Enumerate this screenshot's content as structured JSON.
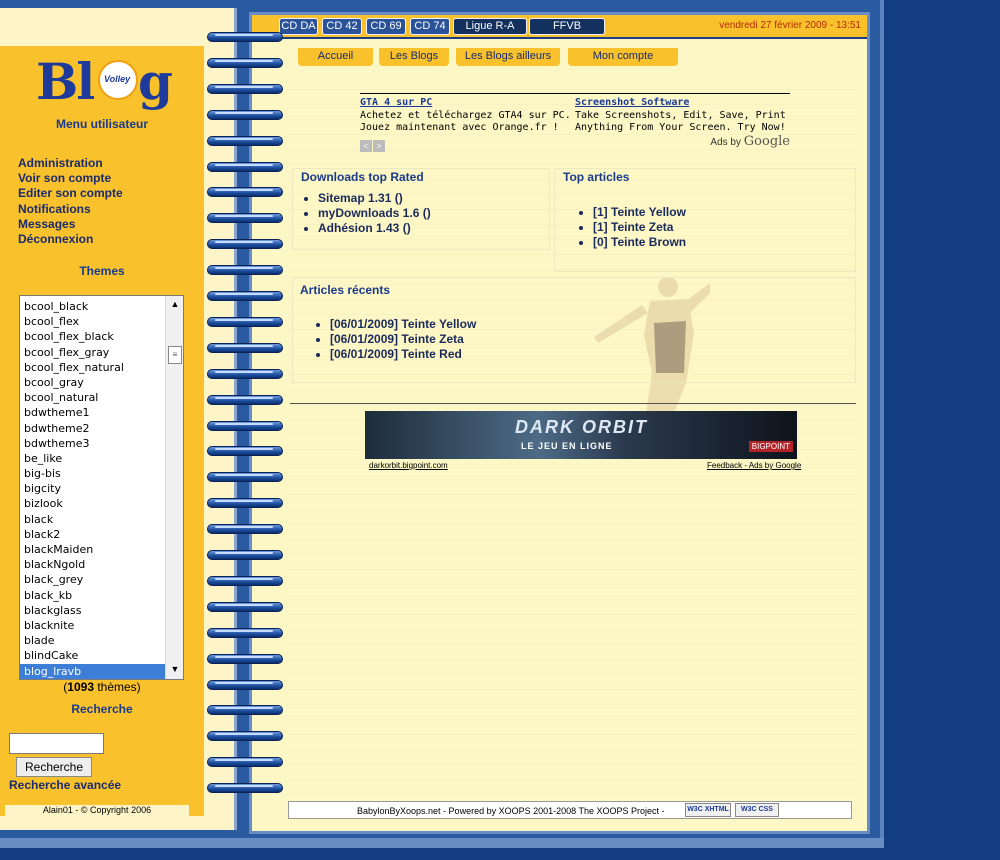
{
  "colors": {
    "accent": "#f9c22c",
    "frame": "#2a5aa0",
    "paper": "#fdf7c6",
    "title": "#1a3a8a"
  },
  "logo": {
    "left": "Bl",
    "right": "g",
    "ball_text": "Volley"
  },
  "sidebar": {
    "menu_title": "Menu utilisateur",
    "menu": [
      "Administration",
      "Voir son compte",
      "Editer son compte",
      "Notifications",
      "Messages",
      "Déconnexion"
    ],
    "themes_title": "Themes",
    "themes": [
      "bcool_black",
      "bcool_flex",
      "bcool_flex_black",
      "bcool_flex_gray",
      "bcool_flex_natural",
      "bcool_gray",
      "bcool_natural",
      "bdwtheme1",
      "bdwtheme2",
      "bdwtheme3",
      "be_like",
      "big-bis",
      "bigcity",
      "bizlook",
      "black",
      "black2",
      "blackMaiden",
      "blackNgold",
      "black_grey",
      "black_kb",
      "blackglass",
      "blacknite",
      "blade",
      "blindCake",
      "blog_lravb"
    ],
    "selected_theme": "blog_lravb",
    "themes_count_open": "(",
    "themes_count": "1093",
    "themes_count_rest": " thèmes)",
    "search_title": "Recherche",
    "search_value": "",
    "search_button": "Recherche",
    "advanced_search": "Recherche avancée",
    "footer": "Alain01 - © Copyright 2006"
  },
  "topbar": {
    "buttons": [
      "CD DA",
      "CD 42",
      "CD 69",
      "CD 74",
      "Ligue R-A",
      "FFVB"
    ],
    "datetime": "vendredi 27 février 2009 - 13:51"
  },
  "tabs": [
    "Accueil",
    "Les Blogs",
    "Les Blogs ailleurs",
    "Mon compte"
  ],
  "ads": {
    "items": [
      {
        "title": "GTA 4 sur PC",
        "line1": "Achetez et téléchargez GTA4 sur PC.",
        "line2": "Jouez maintenant avec Orange.fr !"
      },
      {
        "title": "Screenshot Software",
        "line1": "Take Screenshots, Edit, Save, Print",
        "line2": "Anything From Your Screen. Try Now!"
      }
    ],
    "prev": "<",
    "next": ">",
    "ads_by": "Ads by",
    "google": "Google"
  },
  "downloads": {
    "title": "Downloads top Rated",
    "items": [
      "Sitemap 1.31 ()",
      "myDownloads 1.6 ()",
      "Adhésion 1.43 ()"
    ]
  },
  "top_articles": {
    "title": "Top articles",
    "items": [
      "[1] Teinte Yellow",
      "[1] Teinte Zeta",
      "[0] Teinte Brown"
    ]
  },
  "recent_articles": {
    "title": "Articles récents",
    "items": [
      "[06/01/2009] Teinte Yellow",
      "[06/01/2009] Teinte Zeta",
      "[06/01/2009] Teinte Red"
    ]
  },
  "banner": {
    "title": "DARK ORBIT",
    "subtitle": "LE JEU EN LIGNE",
    "brand": "BIGPOINT",
    "link_left": "darkorbit.bigpoint.com",
    "link_right": "Feedback - Ads by Google"
  },
  "footer": {
    "text": "BabylonByXoops.net - Powered by XOOPS 2001-2008 The XOOPS Project -",
    "badge_xhtml": "W3C XHTML 1.0",
    "badge_css": "W3C CSS"
  }
}
